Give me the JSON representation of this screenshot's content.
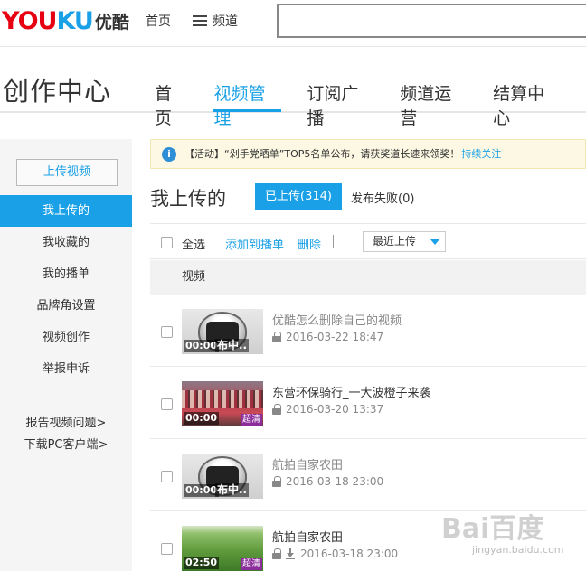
{
  "topbar": {
    "logo": {
      "y": "YOU",
      "ku": "KU",
      "cn": "优酷"
    },
    "home": "首页",
    "channel": "频道",
    "search_value": ""
  },
  "header": {
    "title": "创作中心",
    "nav": [
      {
        "label": "首页",
        "active": false
      },
      {
        "label": "视频管理",
        "active": true
      },
      {
        "label": "订阅广播",
        "active": false
      },
      {
        "label": "频道运营",
        "active": false
      },
      {
        "label": "结算中心",
        "active": false
      }
    ]
  },
  "sidebar": {
    "upload_label": "上传视频",
    "items": [
      {
        "label": "我上传的",
        "active": true
      },
      {
        "label": "我收藏的",
        "active": false
      },
      {
        "label": "我的播单",
        "active": false
      },
      {
        "label": "品牌角设置",
        "active": false
      },
      {
        "label": "视频创作",
        "active": false
      },
      {
        "label": "举报申诉",
        "active": false
      }
    ],
    "links": [
      "报告视频问题>",
      "下载PC客户端>"
    ]
  },
  "notice": {
    "icon": "i",
    "text": "【活动】“剁手党晒单”TOP5名单公布，请获奖道长速来领奖！",
    "link": "持续关注"
  },
  "main": {
    "title": "我上传的",
    "tab_uploaded": "已上传(314)",
    "tab_failed": "发布失败(0)",
    "toolbar": {
      "select_all": "全选",
      "add_to_playlist": "添加到播单",
      "delete": "删除",
      "sort_value": "最近上传"
    },
    "column_header": "视频",
    "accent": "#1aa0e6"
  },
  "videos": [
    {
      "title": "优酷怎么删除自己的视频",
      "date": "2016-03-22 18:47",
      "duration": "00:00",
      "overlay": "布中..",
      "hd": "",
      "thumb": "robot",
      "download": false,
      "grey": true
    },
    {
      "title": "东营环保骑行_一大波橙子来袭",
      "date": "2016-03-20 13:37",
      "duration": "00:00",
      "overlay": "",
      "hd": "超清",
      "thumb": "people",
      "download": false,
      "grey": false
    },
    {
      "title": "航拍自家农田",
      "date": "2016-03-18 23:00",
      "duration": "00:00",
      "overlay": "布中..",
      "hd": "",
      "thumb": "robot",
      "download": false,
      "grey": true
    },
    {
      "title": "航拍自家农田",
      "date": "2016-03-18 23:00",
      "duration": "02:50",
      "overlay": "",
      "hd": "超清",
      "thumb": "field",
      "download": true,
      "grey": false
    }
  ],
  "watermark": {
    "main": "Bai百度",
    "sub": "jingyan.baidu.com"
  }
}
